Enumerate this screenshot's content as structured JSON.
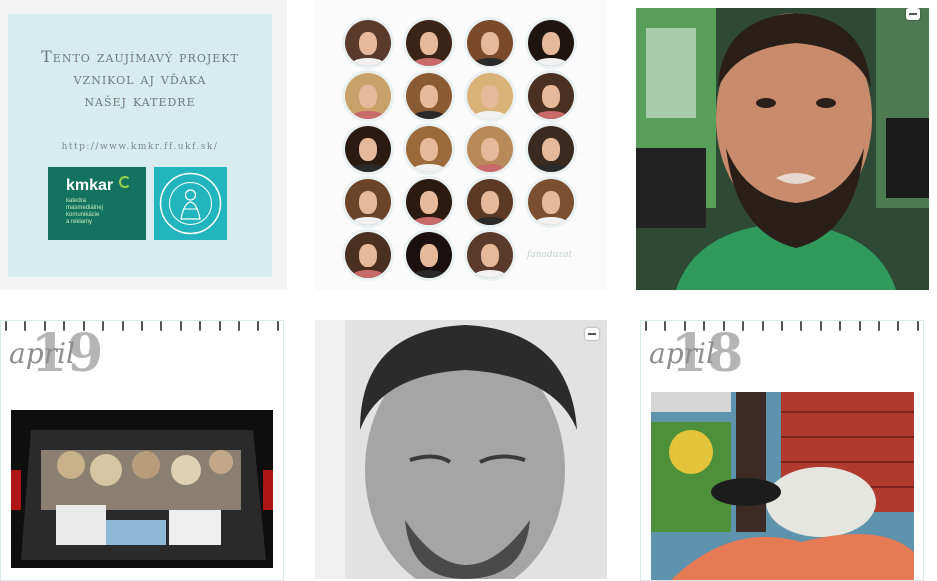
{
  "tiles": {
    "info_card": {
      "headline_line1": "Tento zaujímavý projekt",
      "headline_line2": "vznikol aj vďaka",
      "headline_line3": "našej katedre",
      "url": "http://www.kmkr.ff.ukf.sk/",
      "logo_brand": "kmkar",
      "logo_subtitle": "katedra\nmasmediálnej\nkomunikácie\na reklamy"
    },
    "avatar_grid": {
      "signature": "fanaduzat"
    },
    "calendar_19": {
      "day": "19",
      "month": "april"
    },
    "calendar_18": {
      "day": "18",
      "month": "april"
    }
  },
  "colors": {
    "card_bg": "#d6ecee",
    "logo_green": "#14735e",
    "logo_teal": "#22b5bd",
    "avatar_ring": "#eaf1f2"
  },
  "icons": [
    "multiple-photos-icon",
    "multiple-photos-icon"
  ]
}
